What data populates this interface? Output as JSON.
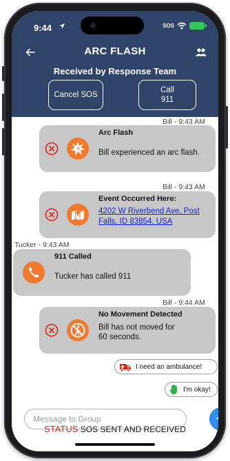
{
  "status_bar": {
    "time": "9:44",
    "sos_indicator": "SOS"
  },
  "header": {
    "title": "ARC FLASH",
    "subtitle": "Received by Response Team",
    "cancel_label": "Cancel SOS",
    "call_label_line1": "Call",
    "call_label_line2": "911"
  },
  "messages": [
    {
      "meta": "Bill - 9:43 AM",
      "title": "Arc Flash",
      "text": "Bill experienced an arc flash.",
      "icon": "arc-flash-icon"
    },
    {
      "meta": "Bill - 9:43 AM",
      "title": "Event Occurred Here:",
      "link_line1": "4202 W Riverbend Ave, Post",
      "link_line2": "Falls, ID 83854, USA",
      "icon": "map-icon"
    },
    {
      "meta": "Tucker - 9:43 AM",
      "title": "911 Called",
      "text": "Tucker has called 911",
      "icon": "phone-icon"
    },
    {
      "meta": "Bill - 9:44 AM",
      "title": "No Movement Detected",
      "text_line1": "Bill has not moved for",
      "text_line2": "60 seconds.",
      "icon": "no-movement-icon"
    }
  ],
  "quick_replies": [
    {
      "label": "I need an ambulance!",
      "icon": "ambulance-icon"
    },
    {
      "label": "I'm okay!",
      "icon": "hand-icon"
    }
  ],
  "composer": {
    "placeholder": "Message to Group"
  },
  "footer": {
    "status_word": "STATUS",
    "status_text": "SOS SENT AND RECEIVED"
  },
  "colors": {
    "header_bg": "#2f4468",
    "accent_orange": "#f07a2e",
    "bubble_bg": "#c8c8c8",
    "send_blue": "#2f8ef0",
    "status_red": "#e0241b",
    "dismiss_red": "#d9291c"
  }
}
